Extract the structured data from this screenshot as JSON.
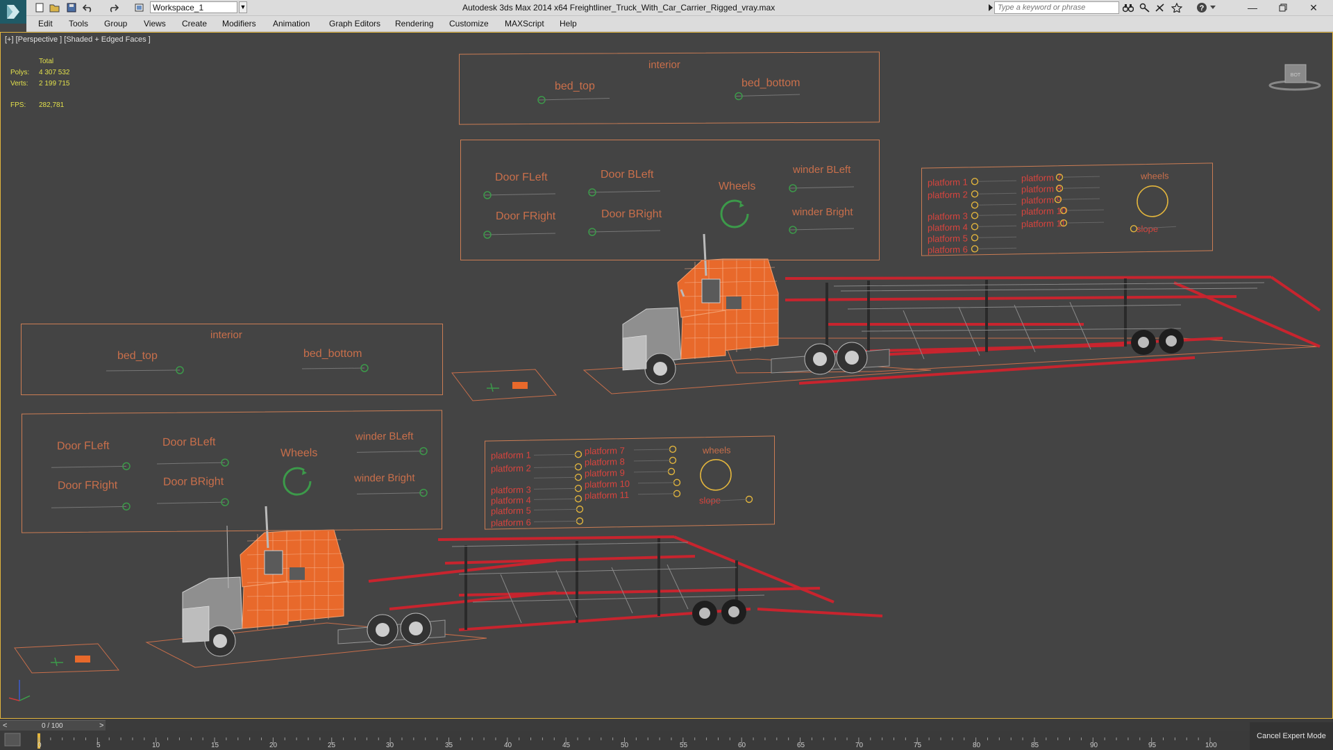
{
  "app": {
    "title": "Autodesk 3ds Max  2014 x64     Freightliner_Truck_With_Car_Carrier_Rigged_vray.max",
    "workspace": "Workspace_1",
    "search_placeholder": "Type a keyword or phrase"
  },
  "menu": [
    "Edit",
    "Tools",
    "Group",
    "Views",
    "Create",
    "Modifiers",
    "Animation",
    "Graph Editors",
    "Rendering",
    "Customize",
    "MAXScript",
    "Help"
  ],
  "viewport": {
    "label": "[+] [Perspective ] [Shaded + Edged Faces ]",
    "stats": {
      "total_label": "Total",
      "polys_label": "Polys:",
      "polys": "4 307 532",
      "verts_label": "Verts:",
      "verts": "2 199 715",
      "fps_label": "FPS:",
      "fps": "282,781"
    }
  },
  "panels": {
    "interior_title": "interior",
    "bed_top": "bed_top",
    "bed_bottom": "bed_bottom",
    "door_fleft": "Door FLeft",
    "door_bleft": "Door BLeft",
    "door_fright": "Door FRight",
    "door_bright": "Door BRight",
    "wheels_cap": "Wheels",
    "winder_bleft": "winder BLeft",
    "winder_bright": "winder Bright",
    "p1": "platform 1",
    "p2": "platform 2",
    "p3": "platform 3",
    "p4": "platform 4",
    "p5": "platform 5",
    "p6": "platform 6",
    "p7": "platform 7",
    "p8": "platform 8",
    "p9": "platform 9",
    "p10": "platform 10",
    "p11": "platform 11",
    "wheels_lower": "wheels",
    "slope": "slope"
  },
  "timeline": {
    "frame": "0 / 100",
    "ticks": [
      "0",
      "5",
      "10",
      "15",
      "20",
      "25",
      "30",
      "35",
      "40",
      "45",
      "50",
      "55",
      "60",
      "65",
      "70",
      "75",
      "80",
      "85",
      "90",
      "95",
      "100"
    ],
    "cancel_label": "Cancel Expert Mode"
  },
  "colors": {
    "viewport_bg": "#444444",
    "panel_orange": "#c96f4b",
    "platform_red": "#d8443e",
    "stats_yellow": "#e2e04c",
    "highlight_border": "#e2b53d",
    "cab_orange": "#e8692b",
    "trailer_red": "#c8242e"
  }
}
